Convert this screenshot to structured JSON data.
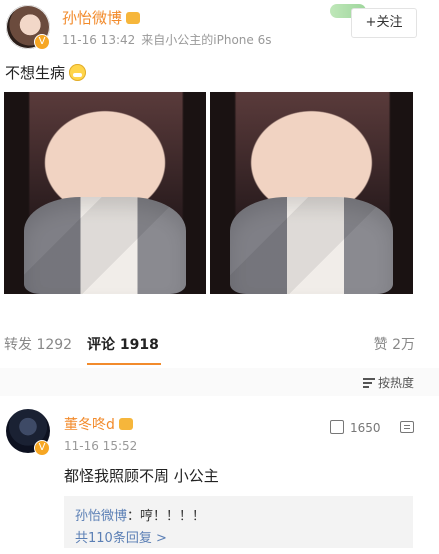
{
  "post": {
    "author_name": "孙怡微博",
    "author_badge": "V",
    "timestamp": "11-16 13:42",
    "source": "来自小公主的iPhone 6s",
    "follow_label": "+关注",
    "text": "不想生病"
  },
  "tabs": {
    "repost": "转发 1292",
    "comment": "评论 1918",
    "like": "赞 2万"
  },
  "sort": {
    "label": "按热度"
  },
  "comment": {
    "name": "董冬咚d",
    "badge": "V",
    "time": "11-16 15:52",
    "likes": "1650",
    "text": "都怪我照顾不周 小公主",
    "reply": {
      "name": "孙怡微博",
      "text": "：哼！！！！",
      "more": "共110条回复 >"
    }
  },
  "colors": {
    "accent": "#f28b2c",
    "link": "#5b7fb5"
  }
}
